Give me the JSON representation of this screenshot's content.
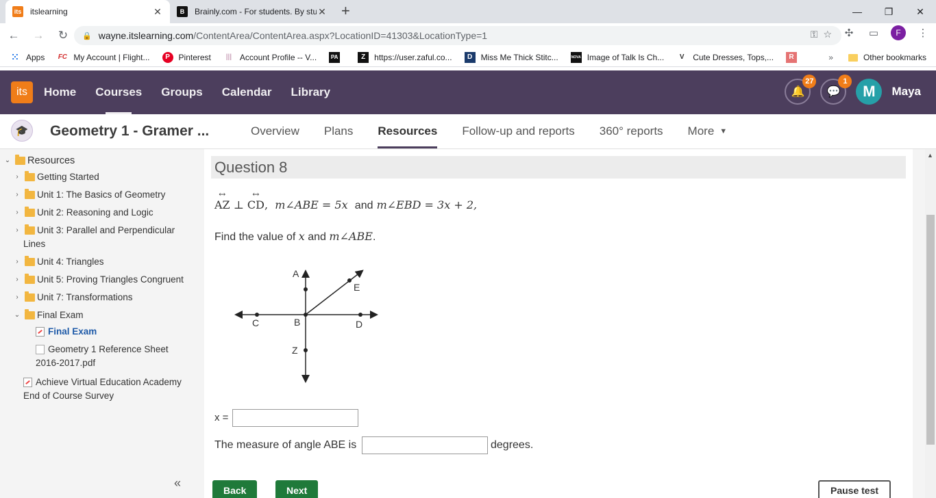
{
  "browser": {
    "tabs": [
      {
        "label": "itslearning",
        "favicon": "its"
      },
      {
        "label": "Brainly.com - For students. By stu",
        "favicon": "B"
      }
    ],
    "url_host": "wayne.itslearning.com",
    "url_path": "/ContentArea/ContentArea.aspx?LocationID=41303&LocationType=1",
    "profile_initial": "F",
    "bookmarks": [
      {
        "label": "Apps",
        "icon": "apps-grid-icon"
      },
      {
        "label": "My Account | Flight...",
        "icon": "FC"
      },
      {
        "label": "Pinterest",
        "icon": "P"
      },
      {
        "label": "Account Profile -- V...",
        "icon": "|||"
      },
      {
        "label": "",
        "icon": "PA"
      },
      {
        "label": "https://user.zaful.co...",
        "icon": "Z"
      },
      {
        "label": "Miss Me Thick Stitc...",
        "icon": "D"
      },
      {
        "label": "Image of Talk Is Ch...",
        "icon": "NOVA"
      },
      {
        "label": "Cute Dresses, Tops,...",
        "icon": "V"
      },
      {
        "label": "",
        "icon": "R"
      }
    ],
    "other_bookmarks": "Other bookmarks"
  },
  "its": {
    "logo": "its",
    "nav": [
      "Home",
      "Courses",
      "Groups",
      "Calendar",
      "Library"
    ],
    "notif_count": "27",
    "msg_count": "1",
    "avatar_initial": "M",
    "user_name": "Maya"
  },
  "course": {
    "title": "Geometry 1 - Gramer ...",
    "tabs": [
      "Overview",
      "Plans",
      "Resources",
      "Follow-up and reports",
      "360° reports",
      "More"
    ]
  },
  "tree": {
    "root": "Resources",
    "items": [
      "Getting Started",
      "Unit 1: The Basics of Geometry",
      "Unit 2: Reasoning and Logic",
      "Unit 3: Parallel and Perpendicular",
      "Lines",
      "Unit 4: Triangles",
      "Unit 5: Proving Triangles Congruent",
      "Unit 7: Transformations",
      "Final Exam",
      "Final Exam",
      "Geometry 1 Reference Sheet",
      "2016-2017.pdf",
      "Achieve Virtual Education Academy",
      "End of Course Survey"
    ]
  },
  "question": {
    "title": "Question 8",
    "given": {
      "line1": "AZ",
      "perp": "⊥",
      "line2": "CD",
      "comma": ",",
      "angle1": "m∠ABE",
      "eq1": "=",
      "expr1": "5x",
      "and": "and",
      "angle2": "m∠EBD",
      "eq2": "=",
      "expr2": "3x + 2,"
    },
    "prompt_text": "Find the value of",
    "prompt_x": "x",
    "prompt_and": "and",
    "prompt_angle": "m∠ABE",
    "prompt_end": ".",
    "diagram_labels": {
      "A": "A",
      "B": "B",
      "C": "C",
      "D": "D",
      "E": "E",
      "Z": "Z"
    },
    "x_label": "x =",
    "x_value": "",
    "angle_label_before": "The measure of angle ABE is",
    "angle_value": "",
    "angle_label_after": "degrees."
  },
  "buttons": {
    "back": "Back",
    "next": "Next",
    "pause": "Pause test"
  },
  "colors": {
    "its_header": "#4c3e5d",
    "its_orange": "#f07d19",
    "button_green": "#1f7a3a"
  }
}
